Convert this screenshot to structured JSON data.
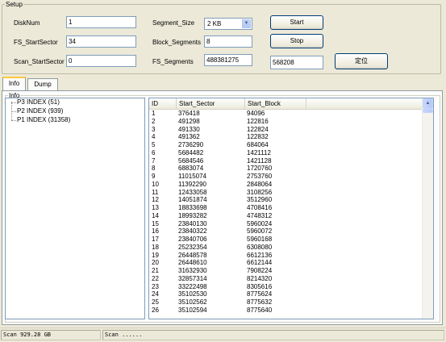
{
  "setup": {
    "title": "Setup",
    "disknum_label": "DiskNum",
    "disknum_value": "1",
    "fs_startsector_label": "FS_StartSector",
    "fs_startsector_value": "34",
    "scan_startsector_label": "Scan_StartSector",
    "scan_startsector_value": "0",
    "segment_size_label": "Segment_Size",
    "segment_size_value": "2 KB",
    "block_segments_label": "Block_Segments",
    "block_segments_value": "8",
    "fs_segments_label": "FS_Segments",
    "fs_segments_value": "488381275",
    "start_label": "Start",
    "stop_label": "Stop",
    "locate_value": "568208",
    "locate_label": "定位"
  },
  "tabs": [
    "Info",
    "Dump"
  ],
  "info": {
    "title": "Info",
    "tree": [
      "P3 INDEX (51)",
      "P2 INDEX (939)",
      "P1 INDEX (31358)"
    ],
    "columns": [
      "ID",
      "Start_Sector",
      "Start_Block"
    ],
    "rows": [
      [
        "1",
        "376418",
        "94096"
      ],
      [
        "2",
        "491298",
        "122816"
      ],
      [
        "3",
        "491330",
        "122824"
      ],
      [
        "4",
        "491362",
        "122832"
      ],
      [
        "5",
        "2736290",
        "684064"
      ],
      [
        "6",
        "5684482",
        "1421112"
      ],
      [
        "7",
        "5684546",
        "1421128"
      ],
      [
        "8",
        "6883074",
        "1720760"
      ],
      [
        "9",
        "11015074",
        "2753760"
      ],
      [
        "10",
        "11392290",
        "2848064"
      ],
      [
        "11",
        "12433058",
        "3108256"
      ],
      [
        "12",
        "14051874",
        "3512960"
      ],
      [
        "13",
        "18833698",
        "4708416"
      ],
      [
        "14",
        "18993282",
        "4748312"
      ],
      [
        "15",
        "23840130",
        "5960024"
      ],
      [
        "16",
        "23840322",
        "5960072"
      ],
      [
        "17",
        "23840706",
        "5960168"
      ],
      [
        "18",
        "25232354",
        "6308080"
      ],
      [
        "19",
        "26448578",
        "6612136"
      ],
      [
        "20",
        "26448610",
        "6612144"
      ],
      [
        "21",
        "31632930",
        "7908224"
      ],
      [
        "22",
        "32857314",
        "8214320"
      ],
      [
        "23",
        "33222498",
        "8305616"
      ],
      [
        "24",
        "35102530",
        "8775624"
      ],
      [
        "25",
        "35102562",
        "8775632"
      ],
      [
        "26",
        "35102594",
        "8775640"
      ]
    ]
  },
  "status": {
    "scan_size": "Scan 929.28 GB",
    "scan_progress": "Scan ......"
  }
}
